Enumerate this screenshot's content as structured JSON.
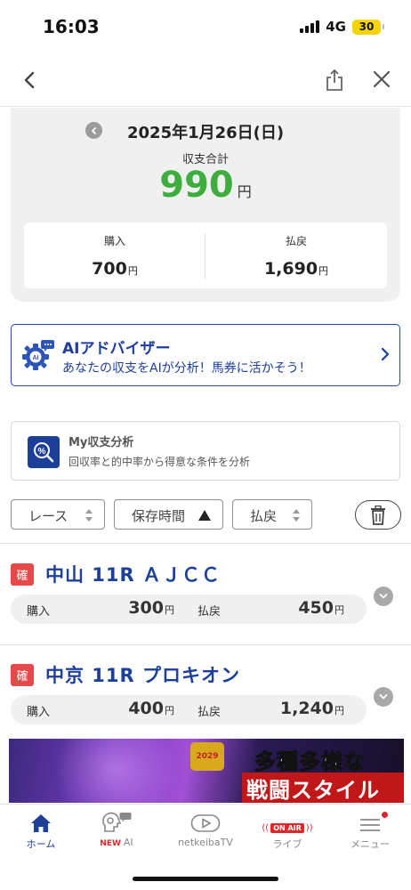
{
  "status_bar": {
    "time": "16:03",
    "network": "4G",
    "battery": "30"
  },
  "summary": {
    "date": "2025年1月26日(日)",
    "total_label": "収支合計",
    "total_value": "990",
    "total_unit": "円",
    "purchase_label": "購入",
    "purchase_value": "700",
    "refund_label": "払戻",
    "refund_value": "1,690",
    "unit": "円"
  },
  "ai_advisor": {
    "title": "AIアドバイザー",
    "subtitle": "あなたの収支をAIが分析！馬券に活かそう！"
  },
  "my_analysis": {
    "title": "My収支分析",
    "subtitle": "回収率と的中率から得意な条件を分析"
  },
  "filters": {
    "race": "レース",
    "saved_time": "保存時間",
    "refund": "払戻"
  },
  "races": [
    {
      "badge": "確",
      "title": "中山 11R ＡＪＣＣ",
      "purchase_label": "購入",
      "purchase": "300",
      "refund_label": "払戻",
      "refund": "450",
      "unit": "円"
    },
    {
      "badge": "確",
      "title": "中京 11R プロキオン",
      "purchase_label": "購入",
      "purchase": "400",
      "refund_label": "払戻",
      "refund": "1,240",
      "unit": "円"
    }
  ],
  "banner": {
    "line1": "多種多様な",
    "line2": "戦闘スタイルで",
    "logo_text": "2029"
  },
  "tabbar": {
    "home": "ホーム",
    "ai_new": "NEW",
    "ai": "AI",
    "tv": "netkeibaTV",
    "live_badge": "ON AIR",
    "live": "ライブ",
    "menu": "メニュー"
  },
  "colors": {
    "accent_blue": "#1d3f9a",
    "profit_green": "#3dae3d",
    "badge_red": "#e54a4a"
  }
}
